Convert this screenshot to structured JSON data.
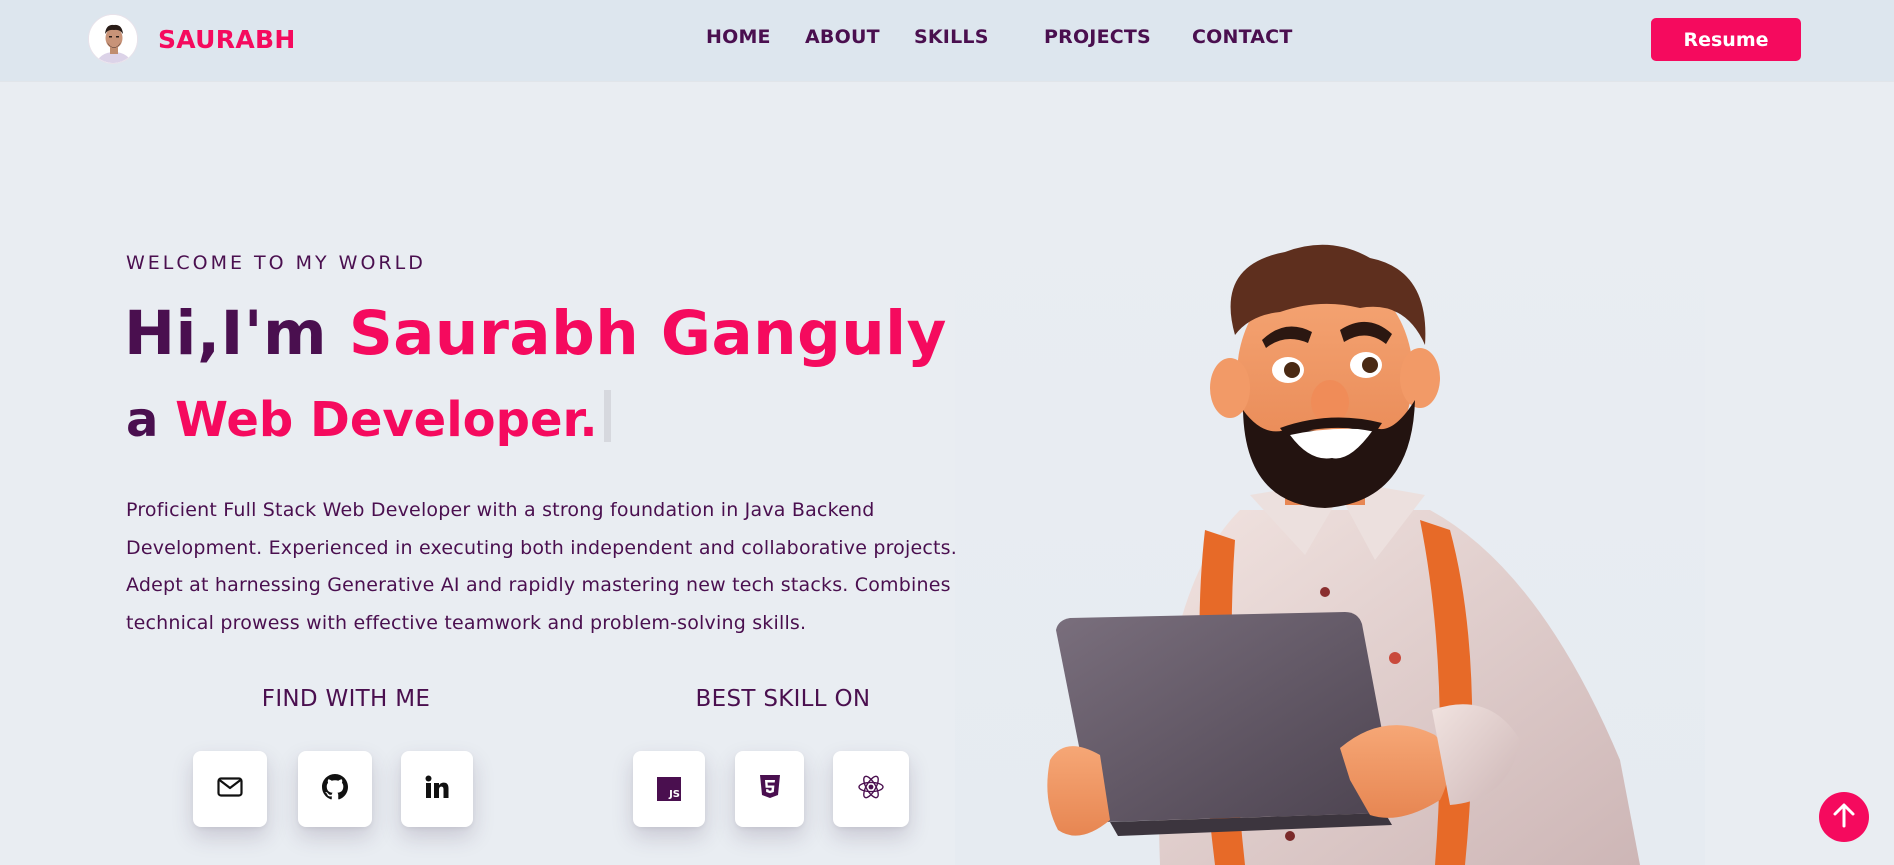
{
  "header": {
    "brand_name": "SAURABH",
    "nav": [
      "HOME",
      "ABOUT",
      "SKILLS",
      "PROJECTS",
      "CONTACT"
    ],
    "resume_label": "Resume"
  },
  "hero": {
    "welcome": "WELCOME TO MY WORLD",
    "greeting": "Hi,I'm ",
    "name": "Saurabh Ganguly",
    "role_prefix": "a ",
    "role": "Web Developer.",
    "bio": "Proficient Full Stack Web Developer with a strong foundation in Java Backend Development. Experienced in executing both independent and collaborative projects. Adept at harnessing Generative AI and rapidly mastering new tech stacks. Combines technical prowess with effective teamwork and problem-solving skills."
  },
  "find_with_me": {
    "heading": "FIND WITH ME",
    "icons": [
      "mail-icon",
      "github-icon",
      "linkedin-icon"
    ]
  },
  "best_skill_on": {
    "heading": "BEST SKILL ON",
    "icons": [
      "javascript-icon",
      "html5-icon",
      "react-icon"
    ],
    "js_label": "JS"
  },
  "colors": {
    "accent": "#f50a5e",
    "text": "#4a0f4f",
    "header_bg": "#dde6ee",
    "page_bg": "#e9edf2"
  }
}
